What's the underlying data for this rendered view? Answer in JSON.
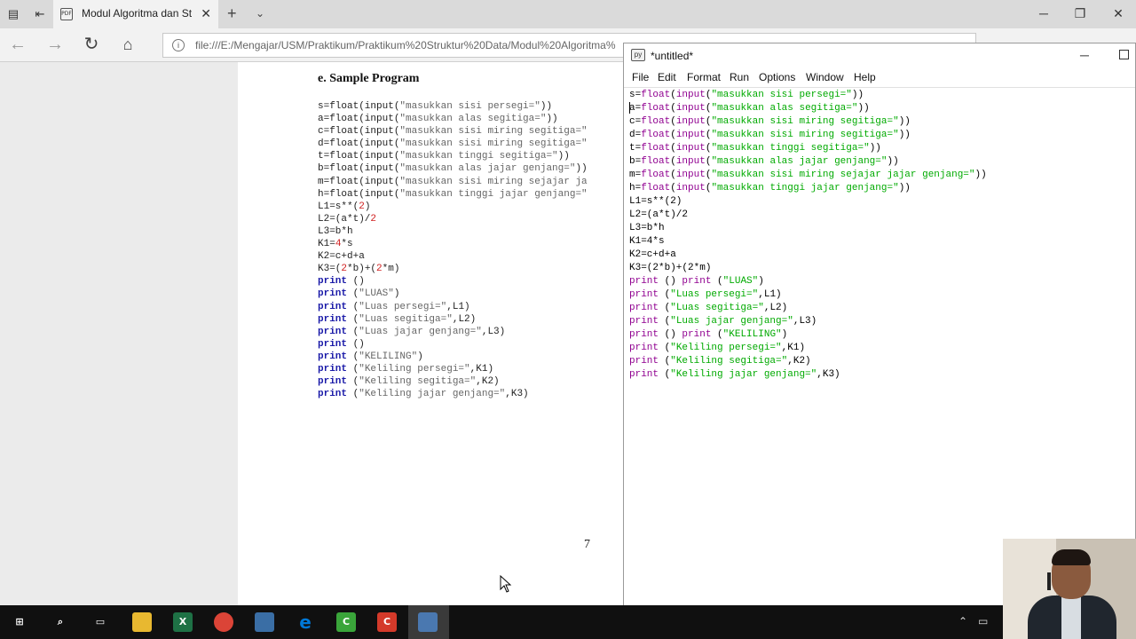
{
  "browser": {
    "tab_title": "Modul Algoritma dan St",
    "url": "file:///E:/Mengajar/USM/Praktikum/Praktikum%20Struktur%20Data/Modul%20Algoritma%",
    "tab_icon": "pdf-icon",
    "nav_icons": [
      "back-arrow-icon",
      "forward-arrow-icon",
      "refresh-icon",
      "home-icon"
    ]
  },
  "pdf": {
    "heading": "e.  Sample Program",
    "page_number": "7",
    "code_lines": [
      [
        [
          "",
          "s=float(input("
        ],
        [
          "str",
          "\"masukkan sisi persegi=\""
        ],
        [
          "",
          "))"
        ]
      ],
      [
        [
          "",
          "a=float(input("
        ],
        [
          "str",
          "\"masukkan alas segitiga=\""
        ],
        [
          "",
          "))"
        ]
      ],
      [
        [
          "",
          "c=float(input("
        ],
        [
          "str",
          "\"masukkan sisi miring segitiga=\""
        ]
      ],
      [
        [
          "",
          "d=float(input("
        ],
        [
          "str",
          "\"masukkan sisi miring segitiga=\""
        ]
      ],
      [
        [
          "",
          "t=float(input("
        ],
        [
          "str",
          "\"masukkan tinggi segitiga=\""
        ],
        [
          "",
          "))"
        ]
      ],
      [
        [
          "",
          "b=float(input("
        ],
        [
          "str",
          "\"masukkan alas jajar genjang=\""
        ],
        [
          "",
          "))"
        ]
      ],
      [
        [
          "",
          "m=float(input("
        ],
        [
          "str",
          "\"masukkan sisi miring sejajar ja"
        ]
      ],
      [
        [
          "",
          "h=float(input("
        ],
        [
          "str",
          "\"masukkan tinggi jajar genjang=\""
        ]
      ],
      [
        [
          "",
          "L1=s**("
        ],
        [
          "num",
          "2"
        ],
        [
          "",
          ")"
        ]
      ],
      [
        [
          "",
          "L2=(a*t)/"
        ],
        [
          "num",
          "2"
        ]
      ],
      [
        [
          "",
          "L3=b*h"
        ]
      ],
      [
        [
          "",
          "K1="
        ],
        [
          "num",
          "4"
        ],
        [
          "",
          "*s"
        ]
      ],
      [
        [
          "",
          "K2=c+d+a"
        ]
      ],
      [
        [
          "",
          "K3=("
        ],
        [
          "num",
          "2"
        ],
        [
          "",
          "*b)+("
        ],
        [
          "num",
          "2"
        ],
        [
          "",
          "*m)"
        ]
      ],
      [
        [
          "kw",
          "print"
        ],
        [
          "",
          " ()"
        ]
      ],
      [
        [
          "kw",
          "print"
        ],
        [
          "",
          " ("
        ],
        [
          "str",
          "\"LUAS\""
        ],
        [
          "",
          ")"
        ]
      ],
      [
        [
          "kw",
          "print"
        ],
        [
          "",
          " ("
        ],
        [
          "str",
          "\"Luas persegi=\""
        ],
        [
          "",
          ",L1)"
        ]
      ],
      [
        [
          "kw",
          "print"
        ],
        [
          "",
          " ("
        ],
        [
          "str",
          "\"Luas segitiga=\""
        ],
        [
          "",
          ",L2)"
        ]
      ],
      [
        [
          "kw",
          "print"
        ],
        [
          "",
          " ("
        ],
        [
          "str",
          "\"Luas jajar genjang=\""
        ],
        [
          "",
          ",L3)"
        ]
      ],
      [
        [
          "kw",
          "print"
        ],
        [
          "",
          " ()"
        ]
      ],
      [
        [
          "kw",
          "print"
        ],
        [
          "",
          " ("
        ],
        [
          "str",
          "\"KELILING\""
        ],
        [
          "",
          ")"
        ]
      ],
      [
        [
          "kw",
          "print"
        ],
        [
          "",
          " ("
        ],
        [
          "str",
          "\"Keliling persegi=\""
        ],
        [
          "",
          ",K1)"
        ]
      ],
      [
        [
          "kw",
          "print"
        ],
        [
          "",
          " ("
        ],
        [
          "str",
          "\"Keliling segitiga=\""
        ],
        [
          "",
          ",K2)"
        ]
      ],
      [
        [
          "kw",
          "print"
        ],
        [
          "",
          " ("
        ],
        [
          "str",
          "\"Keliling jajar genjang=\""
        ],
        [
          "",
          ",K3)"
        ]
      ]
    ]
  },
  "idle": {
    "window_title": "*untitled*",
    "menu": [
      "File",
      "Edit",
      "Format",
      "Run",
      "Options",
      "Window",
      "Help"
    ],
    "lines": [
      [
        [
          "",
          "s="
        ],
        [
          "bi",
          "float"
        ],
        [
          "",
          "("
        ],
        [
          "bi",
          "input"
        ],
        [
          "",
          "("
        ],
        [
          "str",
          "\"masukkan sisi persegi=\""
        ],
        [
          "",
          "))"
        ]
      ],
      [
        [
          "",
          "a="
        ],
        [
          "bi",
          "float"
        ],
        [
          "",
          "("
        ],
        [
          "bi",
          "input"
        ],
        [
          "",
          "("
        ],
        [
          "str",
          "\"masukkan alas segitiga=\""
        ],
        [
          "",
          "))"
        ]
      ],
      [
        [
          "",
          "c="
        ],
        [
          "bi",
          "float"
        ],
        [
          "",
          "("
        ],
        [
          "bi",
          "input"
        ],
        [
          "",
          "("
        ],
        [
          "str",
          "\"masukkan sisi miring segitiga=\""
        ],
        [
          "",
          "))"
        ]
      ],
      [
        [
          "",
          "d="
        ],
        [
          "bi",
          "float"
        ],
        [
          "",
          "("
        ],
        [
          "bi",
          "input"
        ],
        [
          "",
          "("
        ],
        [
          "str",
          "\"masukkan sisi miring segitiga=\""
        ],
        [
          "",
          "))"
        ]
      ],
      [
        [
          "",
          "t="
        ],
        [
          "bi",
          "float"
        ],
        [
          "",
          "("
        ],
        [
          "bi",
          "input"
        ],
        [
          "",
          "("
        ],
        [
          "str",
          "\"masukkan tinggi segitiga=\""
        ],
        [
          "",
          "))"
        ]
      ],
      [
        [
          "",
          "b="
        ],
        [
          "bi",
          "float"
        ],
        [
          "",
          "("
        ],
        [
          "bi",
          "input"
        ],
        [
          "",
          "("
        ],
        [
          "str",
          "\"masukkan alas jajar genjang=\""
        ],
        [
          "",
          "))"
        ]
      ],
      [
        [
          "",
          "m="
        ],
        [
          "bi",
          "float"
        ],
        [
          "",
          "("
        ],
        [
          "bi",
          "input"
        ],
        [
          "",
          "("
        ],
        [
          "str",
          "\"masukkan sisi miring sejajar jajar genjang=\""
        ],
        [
          "",
          "))"
        ]
      ],
      [
        [
          "",
          "h="
        ],
        [
          "bi",
          "float"
        ],
        [
          "",
          "("
        ],
        [
          "bi",
          "input"
        ],
        [
          "",
          "("
        ],
        [
          "str",
          "\"masukkan tinggi jajar genjang=\""
        ],
        [
          "",
          "))"
        ]
      ],
      [
        [
          "",
          "L1=s**(2)"
        ]
      ],
      [
        [
          "",
          "L2=(a*t)/2"
        ]
      ],
      [
        [
          "",
          "L3=b*h"
        ]
      ],
      [
        [
          "",
          "K1=4*s"
        ]
      ],
      [
        [
          "",
          "K2=c+d+a"
        ]
      ],
      [
        [
          "",
          "K3=(2*b)+(2*m)"
        ]
      ],
      [
        [
          "bi",
          "print"
        ],
        [
          "",
          " () "
        ],
        [
          "bi",
          "print"
        ],
        [
          "",
          " ("
        ],
        [
          "str",
          "\"LUAS\""
        ],
        [
          "",
          ")"
        ]
      ],
      [
        [
          "bi",
          "print"
        ],
        [
          "",
          " ("
        ],
        [
          "str",
          "\"Luas persegi=\""
        ],
        [
          "",
          ",L1)"
        ]
      ],
      [
        [
          "bi",
          "print"
        ],
        [
          "",
          " ("
        ],
        [
          "str",
          "\"Luas segitiga=\""
        ],
        [
          "",
          ",L2)"
        ]
      ],
      [
        [
          "bi",
          "print"
        ],
        [
          "",
          " ("
        ],
        [
          "str",
          "\"Luas jajar genjang=\""
        ],
        [
          "",
          ",L3)"
        ]
      ],
      [
        [
          "bi",
          "print"
        ],
        [
          "",
          " () "
        ],
        [
          "bi",
          "print"
        ],
        [
          "",
          " ("
        ],
        [
          "str",
          "\"KELILING\""
        ],
        [
          "",
          ")"
        ]
      ],
      [
        [
          "bi",
          "print"
        ],
        [
          "",
          " ("
        ],
        [
          "str",
          "\"Keliling persegi=\""
        ],
        [
          "",
          ",K1)"
        ]
      ],
      [
        [
          "bi",
          "print"
        ],
        [
          "",
          " ("
        ],
        [
          "str",
          "\"Keliling segitiga=\""
        ],
        [
          "",
          ",K2)"
        ]
      ],
      [
        [
          "bi",
          "print"
        ],
        [
          "",
          " ("
        ],
        [
          "str",
          "\"Keliling jajar genjang=\""
        ],
        [
          "",
          ",K3)"
        ]
      ]
    ]
  },
  "taskbar": {
    "apps": [
      {
        "name": "start-icon",
        "glyph": "⊞",
        "color": "#101010"
      },
      {
        "name": "search-icon",
        "glyph": "⌕",
        "color": "#101010"
      },
      {
        "name": "task-view-icon",
        "glyph": "▭",
        "color": "#101010"
      },
      {
        "name": "file-explorer-icon",
        "glyph": "",
        "color": "#e8b830"
      },
      {
        "name": "excel-icon",
        "glyph": "X",
        "color": "#1e7145"
      },
      {
        "name": "chrome-icon",
        "glyph": "",
        "color": "#db4437"
      },
      {
        "name": "python-icon",
        "glyph": "",
        "color": "#3a6ea5"
      },
      {
        "name": "edge-icon",
        "glyph": "e",
        "color": "#0078d7"
      },
      {
        "name": "camtasia-green-icon",
        "glyph": "C",
        "color": "#3aa53a"
      },
      {
        "name": "camtasia-red-icon",
        "glyph": "C",
        "color": "#d43a2a"
      },
      {
        "name": "idle-editor-icon",
        "glyph": "",
        "color": "#4a78b0"
      }
    ]
  }
}
